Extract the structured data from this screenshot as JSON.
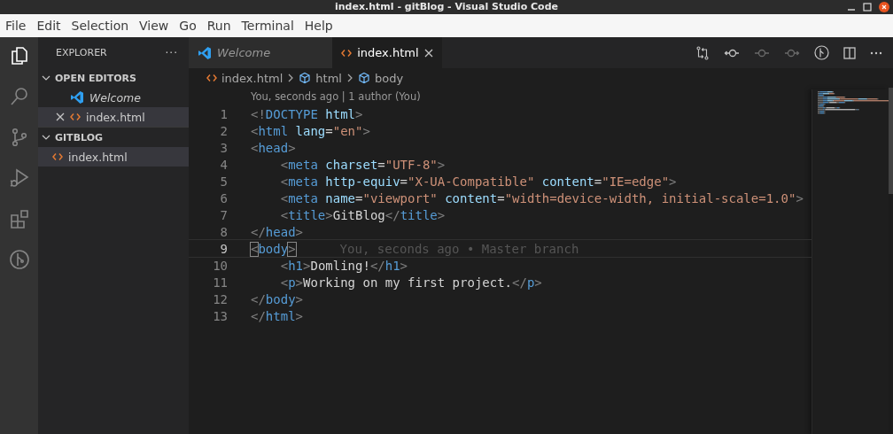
{
  "window": {
    "title": "index.html - gitBlog - Visual Studio Code"
  },
  "menu": [
    "File",
    "Edit",
    "Selection",
    "View",
    "Go",
    "Run",
    "Terminal",
    "Help"
  ],
  "activity_bar": [
    {
      "kind": "files",
      "selected": true
    },
    {
      "kind": "search",
      "selected": false
    },
    {
      "kind": "source-control",
      "selected": false
    },
    {
      "kind": "run",
      "selected": false
    },
    {
      "kind": "extensions",
      "selected": false
    },
    {
      "kind": "git-graph",
      "selected": false
    }
  ],
  "sidebar": {
    "title": "EXPLORER",
    "more": "···",
    "sections": [
      {
        "title": "OPEN EDITORS",
        "expanded": true,
        "items": [
          {
            "label": "Welcome",
            "kind": "welcome",
            "preview": true,
            "closable": false,
            "selected": false
          },
          {
            "label": "index.html",
            "kind": "html",
            "preview": false,
            "closable": true,
            "selected": true
          }
        ]
      },
      {
        "title": "GITBLOG",
        "expanded": true,
        "items": [
          {
            "label": "index.html",
            "kind": "html",
            "selected": true
          }
        ]
      }
    ]
  },
  "tabs": [
    {
      "label": "Welcome",
      "kind": "welcome",
      "preview": true,
      "selected": false,
      "closable": false
    },
    {
      "label": "index.html",
      "kind": "html",
      "preview": false,
      "selected": true,
      "closable": true
    }
  ],
  "toolbar": [
    {
      "kind": "compare"
    },
    {
      "kind": "prev-change"
    },
    {
      "kind": "commit"
    },
    {
      "kind": "next-change"
    },
    {
      "kind": "graph"
    },
    {
      "kind": "split"
    },
    {
      "kind": "more"
    }
  ],
  "breadcrumb": [
    {
      "label": "index.html",
      "kind": "html"
    },
    {
      "label": "html",
      "kind": "symbol"
    },
    {
      "label": "body",
      "kind": "symbol"
    }
  ],
  "codelens": "You, seconds ago | 1 author (You)",
  "lines": [
    {
      "number": "1",
      "current": false,
      "tokens": [
        {
          "kind": "punct",
          "text": "<!"
        },
        {
          "kind": "tag",
          "text": "DOCTYPE"
        },
        {
          "kind": "attr",
          "text": " html"
        },
        {
          "kind": "punct",
          "text": ">"
        }
      ]
    },
    {
      "number": "2",
      "current": false,
      "tokens": [
        {
          "kind": "punct",
          "text": "<"
        },
        {
          "kind": "tag",
          "text": "html"
        },
        {
          "kind": "attr",
          "text": " lang"
        },
        {
          "kind": "text",
          "text": "="
        },
        {
          "kind": "string",
          "text": "\"en\""
        },
        {
          "kind": "punct",
          "text": ">"
        }
      ]
    },
    {
      "number": "3",
      "current": false,
      "tokens": [
        {
          "kind": "punct",
          "text": "<"
        },
        {
          "kind": "tag",
          "text": "head"
        },
        {
          "kind": "punct",
          "text": ">"
        }
      ]
    },
    {
      "number": "4",
      "current": false,
      "tokens": [
        {
          "kind": "punct",
          "text": "    <"
        },
        {
          "kind": "tag",
          "text": "meta"
        },
        {
          "kind": "attr",
          "text": " charset"
        },
        {
          "kind": "text",
          "text": "="
        },
        {
          "kind": "string",
          "text": "\"UTF-8\""
        },
        {
          "kind": "punct",
          "text": ">"
        }
      ]
    },
    {
      "number": "5",
      "current": false,
      "tokens": [
        {
          "kind": "punct",
          "text": "    <"
        },
        {
          "kind": "tag",
          "text": "meta"
        },
        {
          "kind": "attr",
          "text": " http-equiv"
        },
        {
          "kind": "text",
          "text": "="
        },
        {
          "kind": "string",
          "text": "\"X-UA-Compatible\""
        },
        {
          "kind": "attr",
          "text": " content"
        },
        {
          "kind": "text",
          "text": "="
        },
        {
          "kind": "string",
          "text": "\"IE=edge\""
        },
        {
          "kind": "punct",
          "text": ">"
        }
      ]
    },
    {
      "number": "6",
      "current": false,
      "tokens": [
        {
          "kind": "punct",
          "text": "    <"
        },
        {
          "kind": "tag",
          "text": "meta"
        },
        {
          "kind": "attr",
          "text": " name"
        },
        {
          "kind": "text",
          "text": "="
        },
        {
          "kind": "string",
          "text": "\"viewport\""
        },
        {
          "kind": "attr",
          "text": " content"
        },
        {
          "kind": "text",
          "text": "="
        },
        {
          "kind": "string",
          "text": "\"width=device-width, initial-scale=1.0\""
        },
        {
          "kind": "punct",
          "text": ">"
        }
      ]
    },
    {
      "number": "7",
      "current": false,
      "tokens": [
        {
          "kind": "punct",
          "text": "    <"
        },
        {
          "kind": "tag",
          "text": "title"
        },
        {
          "kind": "punct",
          "text": ">"
        },
        {
          "kind": "text",
          "text": "GitBlog"
        },
        {
          "kind": "punct",
          "text": "</"
        },
        {
          "kind": "tag",
          "text": "title"
        },
        {
          "kind": "punct",
          "text": ">"
        }
      ]
    },
    {
      "number": "8",
      "current": false,
      "tokens": [
        {
          "kind": "punct",
          "text": "</"
        },
        {
          "kind": "tag",
          "text": "head"
        },
        {
          "kind": "punct",
          "text": ">"
        }
      ]
    },
    {
      "number": "9",
      "current": true,
      "blame": "You, seconds ago • Master branch",
      "tokens": [
        {
          "kind": "match",
          "text": "<"
        },
        {
          "kind": "tag",
          "text": "body"
        },
        {
          "kind": "match",
          "text": ">"
        }
      ]
    },
    {
      "number": "10",
      "current": false,
      "tokens": [
        {
          "kind": "punct",
          "text": "    <"
        },
        {
          "kind": "tag",
          "text": "h1"
        },
        {
          "kind": "punct",
          "text": ">"
        },
        {
          "kind": "text",
          "text": "Domling!"
        },
        {
          "kind": "punct",
          "text": "</"
        },
        {
          "kind": "tag",
          "text": "h1"
        },
        {
          "kind": "punct",
          "text": ">"
        }
      ]
    },
    {
      "number": "11",
      "current": false,
      "tokens": [
        {
          "kind": "punct",
          "text": "    <"
        },
        {
          "kind": "tag",
          "text": "p"
        },
        {
          "kind": "punct",
          "text": ">"
        },
        {
          "kind": "text",
          "text": "Working on my first project."
        },
        {
          "kind": "punct",
          "text": "</"
        },
        {
          "kind": "tag",
          "text": "p"
        },
        {
          "kind": "punct",
          "text": ">"
        }
      ]
    },
    {
      "number": "12",
      "current": false,
      "tokens": [
        {
          "kind": "punct",
          "text": "</"
        },
        {
          "kind": "tag",
          "text": "body"
        },
        {
          "kind": "punct",
          "text": ">"
        }
      ]
    },
    {
      "number": "13",
      "current": false,
      "tokens": [
        {
          "kind": "punct",
          "text": "</"
        },
        {
          "kind": "tag",
          "text": "html"
        },
        {
          "kind": "punct",
          "text": ">"
        }
      ]
    }
  ]
}
